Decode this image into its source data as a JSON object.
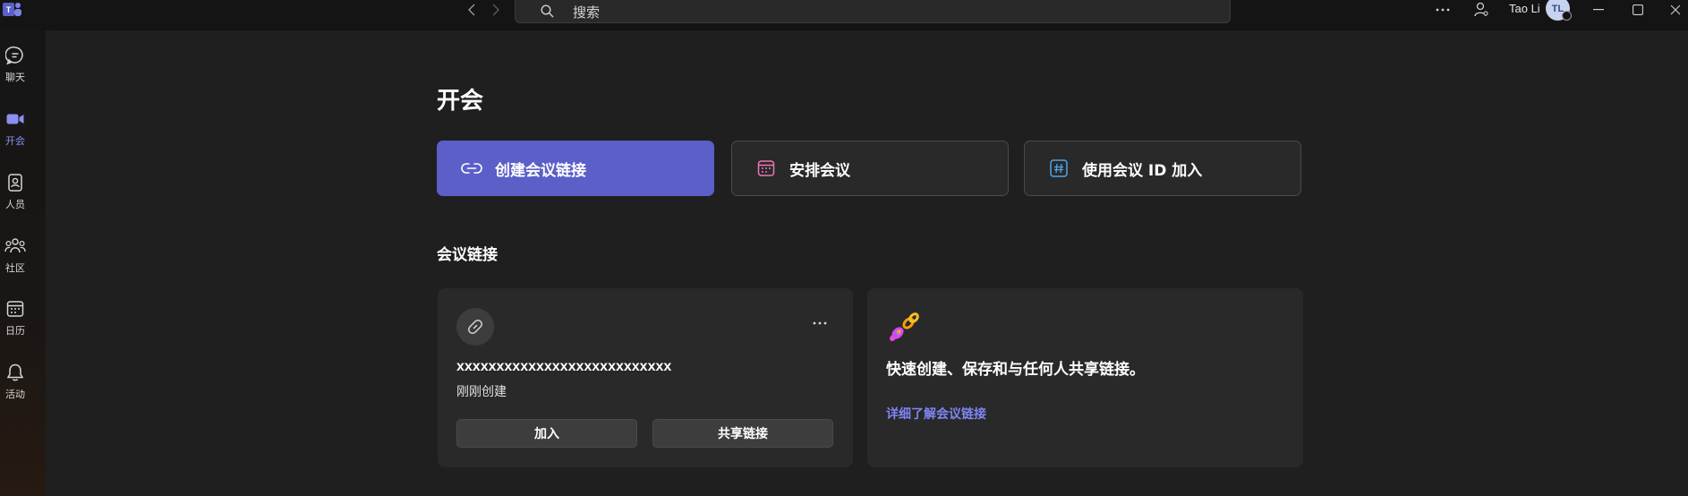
{
  "titlebar": {
    "search_placeholder": "搜索",
    "user_name": "Tao Li",
    "avatar_initials": "TL"
  },
  "rail": {
    "items": [
      {
        "label": "聊天",
        "icon": "chat-icon"
      },
      {
        "label": "开会",
        "icon": "video-camera-icon",
        "active": true
      },
      {
        "label": "人员",
        "icon": "contact-card-icon"
      },
      {
        "label": "社区",
        "icon": "community-icon"
      },
      {
        "label": "日历",
        "icon": "calendar-icon"
      },
      {
        "label": "活动",
        "icon": "bell-icon"
      }
    ]
  },
  "main": {
    "title": "开会",
    "actions": [
      {
        "label": "创建会议链接",
        "icon": "link-icon"
      },
      {
        "label": "安排会议",
        "icon": "calendar-schedule-icon"
      },
      {
        "label": "使用会议 ID 加入",
        "icon": "hashtag-icon"
      }
    ],
    "section_title": "会议链接",
    "link_card": {
      "name": "xxxxxxxxxxxxxxxxxxxxxxxxxxx",
      "subtitle": "刚刚创建",
      "join_label": "加入",
      "share_label": "共享链接"
    },
    "promo_card": {
      "text": "快速创建、保存和与任何人共享链接。",
      "link": "详细了解会议链接"
    }
  },
  "colors": {
    "accent": "#5b5fc7",
    "link_text": "#7f85f5",
    "active_rail": "#8a8ff2",
    "background": "#1f1f1f",
    "card": "#292929"
  }
}
